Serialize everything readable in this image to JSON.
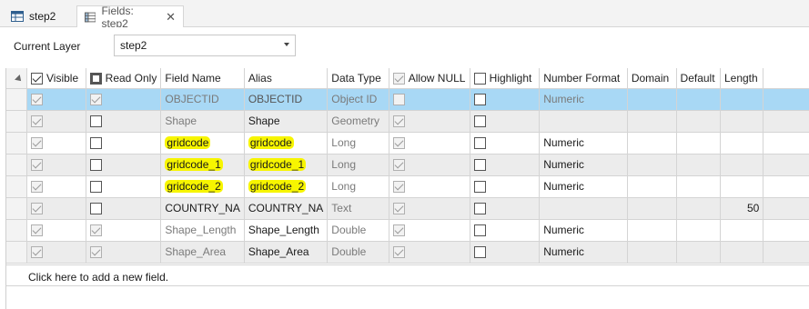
{
  "tabs": [
    {
      "label": "step2"
    },
    {
      "label": "Fields:  step2",
      "close": "✕"
    }
  ],
  "current_layer": {
    "label": "Current Layer",
    "value": "step2"
  },
  "columns": {
    "visible": "Visible",
    "read_only": "Read Only",
    "field_name": "Field Name",
    "alias": "Alias",
    "data_type": "Data Type",
    "allow_null": "Allow NULL",
    "highlight": "Highlight",
    "number_format": "Number Format",
    "domain": "Domain",
    "default": "Default",
    "length": "Length"
  },
  "rows": [
    {
      "visible": true,
      "read_only": true,
      "field_name": "OBJECTID",
      "alias": "OBJECTID",
      "data_type": "Object ID",
      "allow_null": false,
      "highlight": false,
      "number_format": "Numeric",
      "domain": "",
      "default": "",
      "length": ""
    },
    {
      "visible": true,
      "read_only": false,
      "field_name": "Shape",
      "alias": "Shape",
      "data_type": "Geometry",
      "allow_null": true,
      "highlight": false,
      "number_format": "",
      "domain": "",
      "default": "",
      "length": ""
    },
    {
      "visible": true,
      "read_only": false,
      "field_name": "gridcode",
      "alias": "gridcode",
      "data_type": "Long",
      "allow_null": true,
      "highlight": false,
      "number_format": "Numeric",
      "domain": "",
      "default": "",
      "length": ""
    },
    {
      "visible": true,
      "read_only": false,
      "field_name": "gridcode_1",
      "alias": "gridcode_1",
      "data_type": "Long",
      "allow_null": true,
      "highlight": false,
      "number_format": "Numeric",
      "domain": "",
      "default": "",
      "length": ""
    },
    {
      "visible": true,
      "read_only": false,
      "field_name": "gridcode_2",
      "alias": "gridcode_2",
      "data_type": "Long",
      "allow_null": true,
      "highlight": false,
      "number_format": "Numeric",
      "domain": "",
      "default": "",
      "length": ""
    },
    {
      "visible": true,
      "read_only": false,
      "field_name": "COUNTRY_NA",
      "alias": "COUNTRY_NA",
      "data_type": "Text",
      "allow_null": true,
      "highlight": false,
      "number_format": "",
      "domain": "",
      "default": "",
      "length": "50"
    },
    {
      "visible": true,
      "read_only": true,
      "field_name": "Shape_Length",
      "alias": "Shape_Length",
      "data_type": "Double",
      "allow_null": true,
      "highlight": false,
      "number_format": "Numeric",
      "domain": "",
      "default": "",
      "length": ""
    },
    {
      "visible": true,
      "read_only": true,
      "field_name": "Shape_Area",
      "alias": "Shape_Area",
      "data_type": "Double",
      "allow_null": true,
      "highlight": false,
      "number_format": "Numeric",
      "domain": "",
      "default": "",
      "length": ""
    }
  ],
  "add_field": "Click here to add a new field.",
  "colors": {
    "selected_row": "#a8d8f5",
    "highlight_marker": "#f7f500"
  }
}
